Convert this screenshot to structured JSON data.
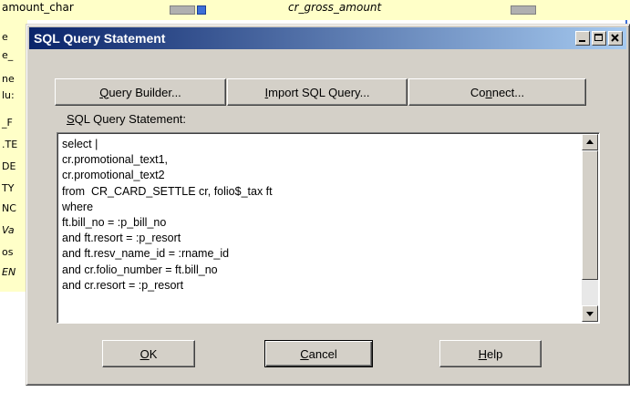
{
  "background": {
    "col1_text": "amount_char",
    "col2_text": "cr_gross_amount",
    "row_fragments": [
      "e",
      "e_",
      "ne",
      "lu:",
      "_F",
      ".TE",
      "DE",
      "TY",
      "NC",
      "Va",
      "os",
      "EN"
    ]
  },
  "dialog": {
    "title": "SQL Query Statement",
    "buttons": {
      "query_builder": {
        "mnemonic": "Q",
        "rest": "uery Builder..."
      },
      "import_sql": {
        "mnemonic": "I",
        "rest": "mport SQL Query..."
      },
      "connect": {
        "pre": "Co",
        "mnemonic": "n",
        "rest": "nect..."
      },
      "ok": {
        "mnemonic": "O",
        "rest": "K"
      },
      "cancel": {
        "mnemonic": "C",
        "rest": "ancel"
      },
      "help": {
        "mnemonic": "H",
        "rest": "elp"
      }
    },
    "sql_label": {
      "mnemonic": "S",
      "rest": "QL Query Statement:"
    },
    "sql_text": "select |\ncr.promotional_text1,\ncr.promotional_text2\nfrom  CR_CARD_SETTLE cr, folio$_tax ft\nwhere\nft.bill_no = :p_bill_no\nand ft.resort = :p_resort\nand ft.resv_name_id = :rname_id\nand cr.folio_number = ft.bill_no\nand cr.resort = :p_resort",
    "icons": {
      "minimize": "minimize-icon",
      "maximize": "maximize-icon",
      "close": "close-icon",
      "scroll_up": "arrow-up-icon",
      "scroll_down": "arrow-down-icon"
    }
  },
  "colors": {
    "title_start": "#0a246a",
    "title_end": "#a6caf0",
    "dialog_face": "#d4d0c8",
    "background_field": "#ffffc8"
  }
}
